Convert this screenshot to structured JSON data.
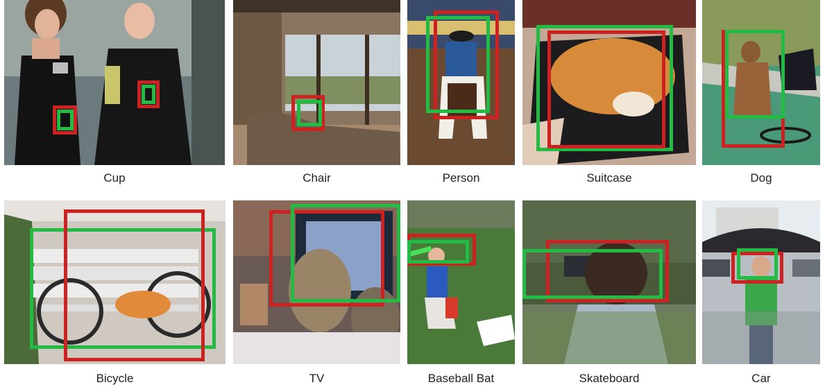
{
  "colors": {
    "ground_truth_box": "#22bb44",
    "prediction_box": "#cc2222"
  },
  "examples": [
    {
      "label": "Cup"
    },
    {
      "label": "Chair"
    },
    {
      "label": "Person"
    },
    {
      "label": "Suitcase"
    },
    {
      "label": "Dog"
    },
    {
      "label": "Bicycle"
    },
    {
      "label": "TV"
    },
    {
      "label": "Baseball Bat"
    },
    {
      "label": "Skateboard"
    },
    {
      "label": "Car"
    }
  ]
}
